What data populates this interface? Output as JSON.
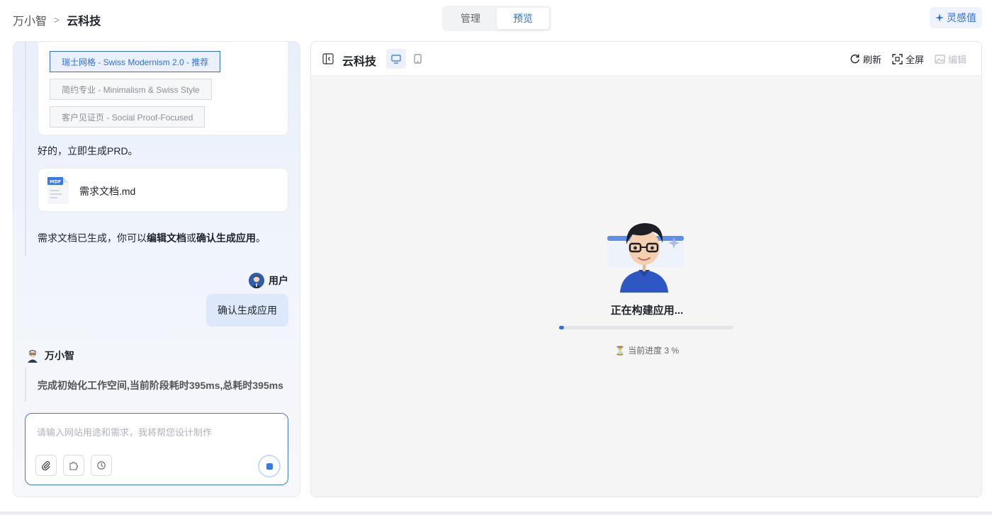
{
  "header": {
    "breadcrumb_root": "万小智",
    "breadcrumb_sep": ">",
    "breadcrumb_current": "云科技",
    "tabs": [
      {
        "label": "管理",
        "active": false
      },
      {
        "label": "预览",
        "active": true
      }
    ],
    "inspiration_label": "灵感值"
  },
  "chat": {
    "style_options": [
      {
        "label": "瑞士网格 - Swiss Modernism 2.0 - 推荐",
        "selected": true
      },
      {
        "label": "简约专业 - Minimalism & Swiss Style",
        "selected": false
      },
      {
        "label": "客户见证页 - Social Proof-Focused",
        "selected": false
      }
    ],
    "reply_generate": "好的，立即生成PRD。",
    "file": {
      "badge": "MDF",
      "name": "需求文档.md"
    },
    "doc_done_prefix": "需求文档已生成，你可以",
    "doc_done_link1": "编辑文档",
    "doc_done_mid": "或",
    "doc_done_link2": "确认生成应用",
    "doc_done_suffix": "。",
    "user_name": "用户",
    "user_message": "确认生成应用",
    "bot_name": "万小智",
    "status_message": "完成初始化工作空间,当前阶段耗时395ms,总耗时395ms",
    "input_placeholder": "请输入网站用途和需求，我将帮您设计制作"
  },
  "preview": {
    "title": "云科技",
    "refresh_label": "刷新",
    "fullscreen_label": "全屏",
    "edit_label": "编辑",
    "building_text": "正在构建应用...",
    "progress_percent": 3,
    "progress_label": "⏳ 当前进度 3 %"
  },
  "colors": {
    "accent": "#2f6fe4",
    "bubble": "#dde8fa"
  }
}
